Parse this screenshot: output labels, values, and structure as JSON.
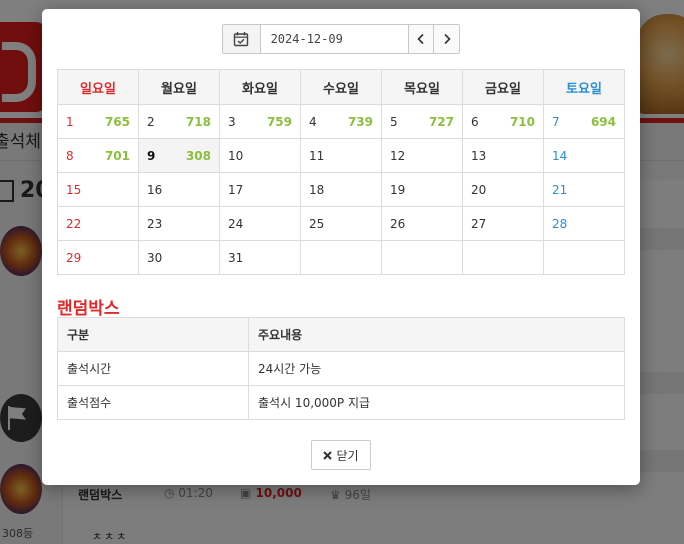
{
  "background": {
    "tab_text": "출석체",
    "year_text": "20",
    "rank_text": "308등",
    "entry": {
      "name": "랜덤박스",
      "time": "01:20",
      "points": "10,000",
      "days": "96일",
      "note": "ㅊㅊㅊ"
    }
  },
  "modal": {
    "datebar": {
      "date_value": "2024-12-09",
      "calendar_icon": "calendar-check-icon",
      "prev_icon": "chevron-left-icon",
      "next_icon": "chevron-right-icon"
    },
    "calendar": {
      "weekdays": [
        "일요일",
        "월요일",
        "화요일",
        "수요일",
        "목요일",
        "금요일",
        "토요일"
      ],
      "weeks": [
        [
          {
            "day": "1",
            "count": "765"
          },
          {
            "day": "2",
            "count": "718"
          },
          {
            "day": "3",
            "count": "759"
          },
          {
            "day": "4",
            "count": "739"
          },
          {
            "day": "5",
            "count": "727"
          },
          {
            "day": "6",
            "count": "710"
          },
          {
            "day": "7",
            "count": "694"
          }
        ],
        [
          {
            "day": "8",
            "count": "701"
          },
          {
            "day": "9",
            "count": "308"
          },
          {
            "day": "10",
            "count": ""
          },
          {
            "day": "11",
            "count": ""
          },
          {
            "day": "12",
            "count": ""
          },
          {
            "day": "13",
            "count": ""
          },
          {
            "day": "14",
            "count": ""
          }
        ],
        [
          {
            "day": "15",
            "count": ""
          },
          {
            "day": "16",
            "count": ""
          },
          {
            "day": "17",
            "count": ""
          },
          {
            "day": "18",
            "count": ""
          },
          {
            "day": "19",
            "count": ""
          },
          {
            "day": "20",
            "count": ""
          },
          {
            "day": "21",
            "count": ""
          }
        ],
        [
          {
            "day": "22",
            "count": ""
          },
          {
            "day": "23",
            "count": ""
          },
          {
            "day": "24",
            "count": ""
          },
          {
            "day": "25",
            "count": ""
          },
          {
            "day": "26",
            "count": ""
          },
          {
            "day": "27",
            "count": ""
          },
          {
            "day": "28",
            "count": ""
          }
        ],
        [
          {
            "day": "29",
            "count": ""
          },
          {
            "day": "30",
            "count": ""
          },
          {
            "day": "31",
            "count": ""
          },
          {
            "day": "",
            "count": ""
          },
          {
            "day": "",
            "count": ""
          },
          {
            "day": "",
            "count": ""
          },
          {
            "day": "",
            "count": ""
          }
        ]
      ],
      "today": "9",
      "colors": {
        "sunday": "#e02b2b",
        "saturday": "#2a8fd0",
        "count": "#8bbf3c"
      }
    },
    "section_title": "랜덤박스",
    "info_table": {
      "headers": [
        "구분",
        "주요내용"
      ],
      "rows": [
        [
          "출석시간",
          "24시간 가능"
        ],
        [
          "출석점수",
          "출석시 10,000P 지급"
        ]
      ]
    },
    "close_button": {
      "label": "닫기",
      "icon": "close-x-icon"
    }
  }
}
